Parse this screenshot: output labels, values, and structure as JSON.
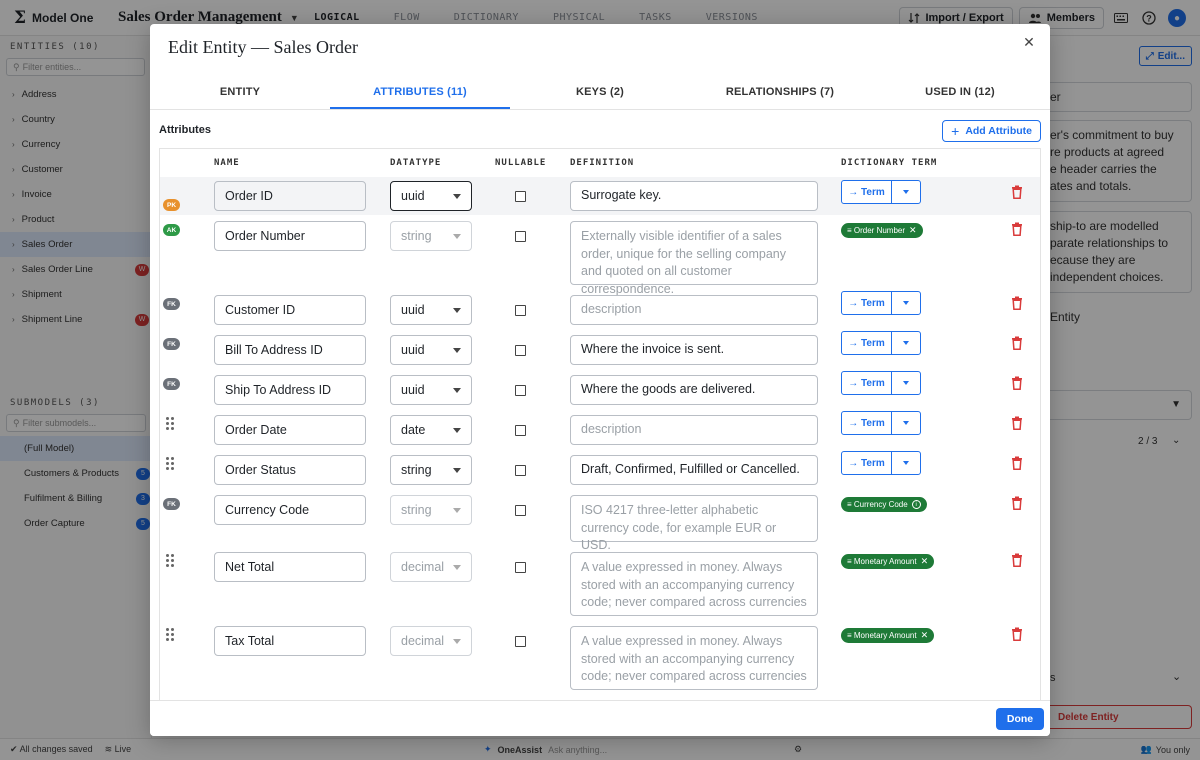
{
  "app": {
    "brand": "Model One",
    "model_name": "Sales Order Management",
    "nav": [
      "LOGICAL",
      "FLOW",
      "DICTIONARY",
      "PHYSICAL",
      "TASKS",
      "VERSIONS"
    ],
    "active_nav": "LOGICAL",
    "import_export": "Import / Export",
    "members": "Members"
  },
  "sidebar": {
    "entities_header": "ENTITIES (10)",
    "filter_placeholder": "Filter entities...",
    "entities": [
      {
        "label": "Address"
      },
      {
        "label": "Country"
      },
      {
        "label": "Currency"
      },
      {
        "label": "Customer"
      },
      {
        "label": "Invoice"
      },
      {
        "label": "Product"
      },
      {
        "label": "Sales Order",
        "selected": true
      },
      {
        "label": "Sales Order Line",
        "badge": "W"
      },
      {
        "label": "Shipment"
      },
      {
        "label": "Shipment Line",
        "badge": "W"
      }
    ],
    "submodels_header": "SUBMODELS (3)",
    "submodel_filter_placeholder": "Filter submodels...",
    "submodels": [
      {
        "label": "(Full Model)",
        "selected": true
      },
      {
        "label": "Customers & Products",
        "badge": "5"
      },
      {
        "label": "Fulfilment & Billing",
        "badge": "3"
      },
      {
        "label": "Order Capture",
        "badge": "5"
      }
    ]
  },
  "right_panel": {
    "edit_label": "Edit...",
    "field_fragment": "er",
    "desc_fragment": "er's commitment to buy\nre products at agreed\ne header carries the\nates and totals.",
    "note_fragment": "ship-to are modelled\nparate relationships to\necause they are\nindependent choices.",
    "entity_fragment": "Entity",
    "pager": "2 / 3",
    "s_fragment": "s",
    "delete_label": "Delete Entity"
  },
  "status": {
    "saved": "All changes saved",
    "live": "Live",
    "assist": "OneAssist",
    "assist_placeholder": "Ask anything...",
    "visibility": "You only"
  },
  "modal": {
    "title": "Edit Entity — Sales Order",
    "tabs": [
      {
        "label": "ENTITY"
      },
      {
        "label": "ATTRIBUTES (11)",
        "active": true
      },
      {
        "label": "KEYS (2)"
      },
      {
        "label": "RELATIONSHIPS (7)"
      },
      {
        "label": "USED IN (12)"
      }
    ],
    "section_title": "Attributes",
    "add_button": "Add Attribute",
    "columns": {
      "name": "NAME",
      "datatype": "DATATYPE",
      "nullable": "NULLABLE",
      "definition": "DEFINITION",
      "dictionary_term": "DICTIONARY TERM"
    },
    "term_button": "→ Term",
    "done": "Done",
    "rows": [
      {
        "key": "PK",
        "name": "Order ID",
        "datatype": "uuid",
        "datatype_state": "focused",
        "nullable": false,
        "definition": "Surrogate key.",
        "definition_placeholder": false,
        "term": null
      },
      {
        "key": "AK",
        "name": "Order Number",
        "datatype": "string",
        "datatype_state": "disabled",
        "nullable": false,
        "definition": "Externally visible identifier of a sales order, unique for the selling company and quoted on all customer correspondence.",
        "definition_placeholder": true,
        "term": "≡ Order Number"
      },
      {
        "key": "FK",
        "name": "Customer ID",
        "datatype": "uuid",
        "datatype_state": "normal",
        "nullable": false,
        "definition": "description",
        "definition_placeholder": true,
        "term": null
      },
      {
        "key": "FK",
        "name": "Bill To Address ID",
        "datatype": "uuid",
        "datatype_state": "normal",
        "nullable": false,
        "definition": "Where the invoice is sent.",
        "definition_placeholder": false,
        "term": null
      },
      {
        "key": "FK",
        "name": "Ship To Address ID",
        "datatype": "uuid",
        "datatype_state": "normal",
        "nullable": false,
        "definition": "Where the goods are delivered.",
        "definition_placeholder": false,
        "term": null
      },
      {
        "key": null,
        "name": "Order Date",
        "datatype": "date",
        "datatype_state": "normal",
        "nullable": false,
        "definition": "description",
        "definition_placeholder": true,
        "term": null
      },
      {
        "key": null,
        "name": "Order Status",
        "datatype": "string",
        "datatype_state": "normal",
        "nullable": false,
        "definition": "Draft, Confirmed, Fulfilled or Cancelled.",
        "definition_placeholder": false,
        "term": null
      },
      {
        "key": "FK",
        "name": "Currency Code",
        "datatype": "string",
        "datatype_state": "disabled",
        "nullable": false,
        "definition": "ISO 4217 three-letter alphabetic currency code, for example EUR or USD.",
        "definition_placeholder": true,
        "term": "≡ Currency Code",
        "term_icon": "info-icon"
      },
      {
        "key": null,
        "name": "Net Total",
        "datatype": "decimal",
        "datatype_state": "disabled",
        "nullable": false,
        "definition": "A value expressed in money. Always stored with an accompanying currency code; never compared across currencies",
        "definition_placeholder": true,
        "term": "≡ Monetary Amount"
      },
      {
        "key": null,
        "name": "Tax Total",
        "datatype": "decimal",
        "datatype_state": "disabled",
        "nullable": false,
        "definition": "A value expressed in money. Always stored with an accompanying currency code; never compared across currencies",
        "definition_placeholder": true,
        "term": "≡ Monetary Amount"
      }
    ]
  },
  "colors": {
    "accent": "#1f6feb",
    "pk": "#e8912d",
    "ak": "#2e9a47",
    "fk": "#6b7078",
    "term_chip": "#1e7a37",
    "danger": "#d93b3b"
  }
}
